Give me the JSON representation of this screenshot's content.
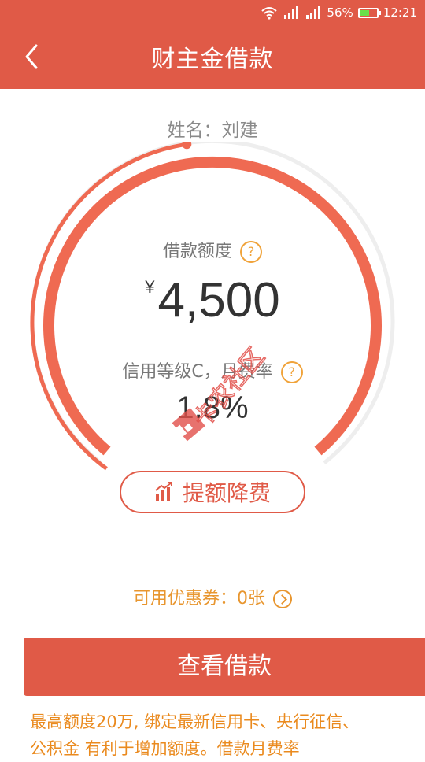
{
  "status_bar": {
    "battery_percent": "56%",
    "battery_level": 0.56,
    "time": "12:21",
    "icons": [
      "wifi-icon",
      "signal-icon",
      "signal-icon",
      "battery-icon"
    ]
  },
  "header": {
    "back_icon": "chevron-left-icon",
    "title": "财主金借款"
  },
  "user": {
    "name_label": "姓名：",
    "name": "刘建"
  },
  "gauge": {
    "progress": 0.97
  },
  "credit": {
    "label": "借款额度",
    "help_icon": "?",
    "currency": "¥",
    "amount": "4,500"
  },
  "rate": {
    "label": "信用等级C，月费率",
    "help_icon": "?",
    "value": "1.8%"
  },
  "boost_button": {
    "icon": "bar-chart-icon",
    "label": "提额降费"
  },
  "coupon": {
    "label": "可用优惠券：",
    "count": "0张"
  },
  "view_button": {
    "label": "查看借款"
  },
  "promo": {
    "line1": "最高额度20万, 绑定最新信用卡、央行征信、",
    "line2": "公积金 有利于增加额度。借款月费率"
  },
  "watermark": {
    "text": "卡农社区"
  },
  "colors": {
    "brand_red": "#e05a47",
    "gauge_red": "#ef6a52",
    "accent_orange": "#e8962f",
    "track_gray": "#eeeeee"
  }
}
